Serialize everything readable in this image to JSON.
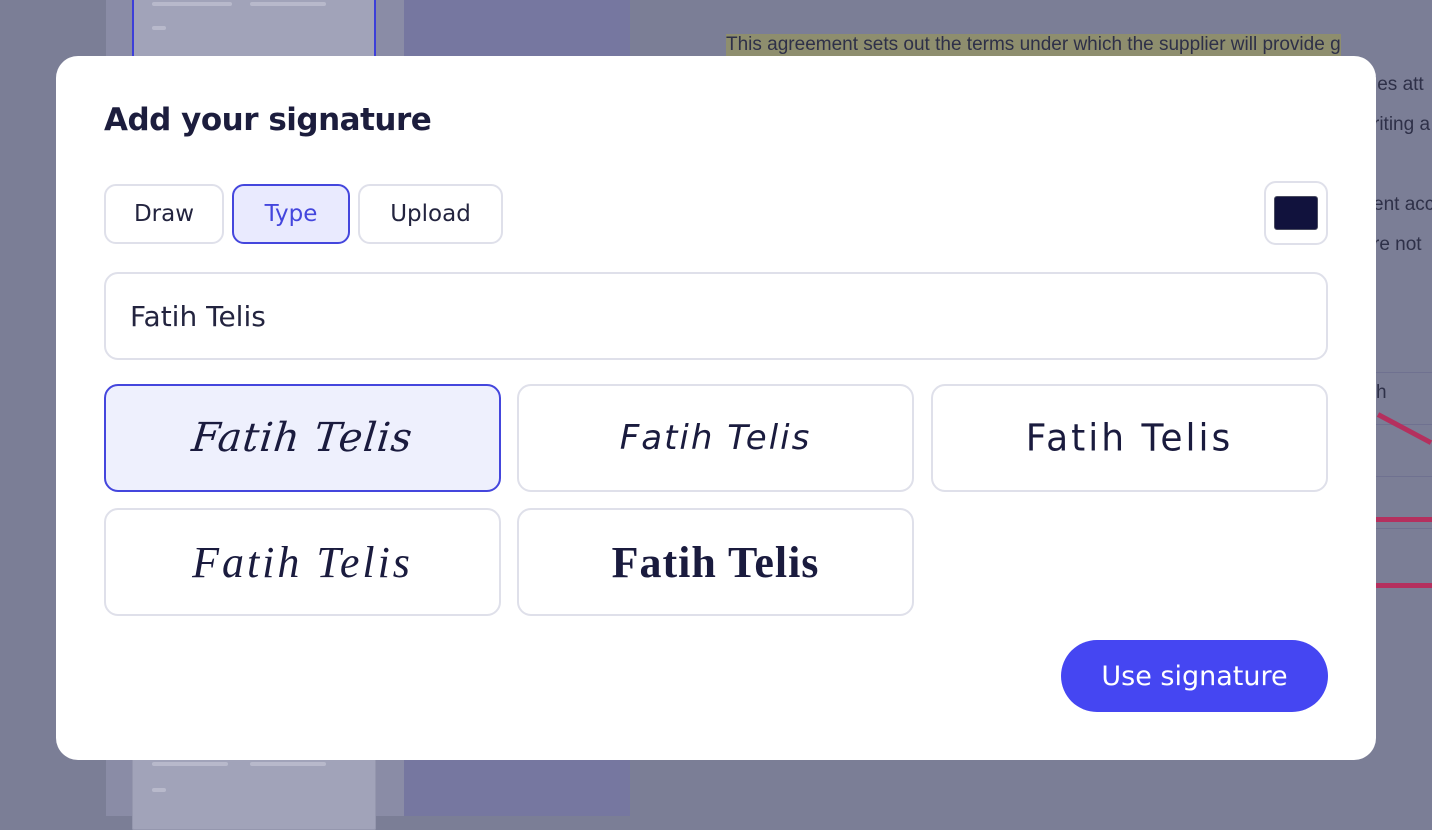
{
  "document": {
    "lines": [
      "This agreement sets out the terms under which the supplier will provide g",
      "les att",
      "riting a",
      "ent acc",
      "re not",
      "h"
    ]
  },
  "modal": {
    "title": "Add your signature",
    "tabs": [
      {
        "label": "Draw",
        "active": false
      },
      {
        "label": "Type",
        "active": true
      },
      {
        "label": "Upload",
        "active": false
      }
    ],
    "ink_color": "#11123d",
    "name_input": {
      "value": "Fatih Telis",
      "placeholder": ""
    },
    "signature_styles": [
      {
        "text": "Fatih Telis",
        "selected": true
      },
      {
        "text": "Fatih Telis",
        "selected": false
      },
      {
        "text": "Fatih Telis",
        "selected": false
      },
      {
        "text": "Fatih Telis",
        "selected": false
      },
      {
        "text": "Fatih Telis",
        "selected": false
      }
    ],
    "submit_label": "Use signature"
  },
  "colors": {
    "accent": "#4546f2",
    "selected_border": "#4446dd",
    "selected_bg": "#eef0fd",
    "highlight": "#8e8e6e"
  }
}
